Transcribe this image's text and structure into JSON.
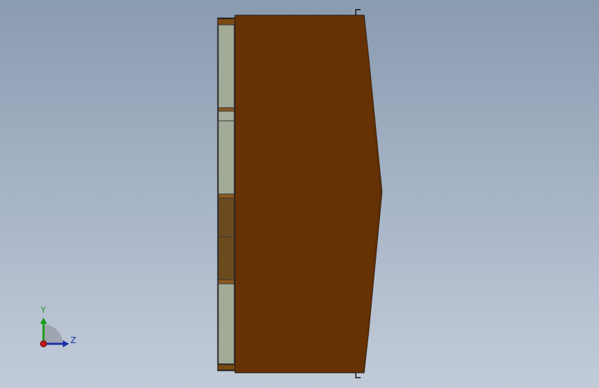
{
  "view": {
    "title": "",
    "colors": {
      "background_top": "#8a9bb0",
      "background_bottom": "#c2cbd8",
      "body_fill": "#663204",
      "panel_light": "#a2aa98",
      "panel_dark": "#6b4a1e",
      "outline": "#1a1a1a"
    }
  },
  "triad": {
    "y_label": "Y",
    "z_label": "Z",
    "y_color": "#1a9a1a",
    "z_color": "#1c2fa8",
    "origin_color": "#c0181c"
  }
}
